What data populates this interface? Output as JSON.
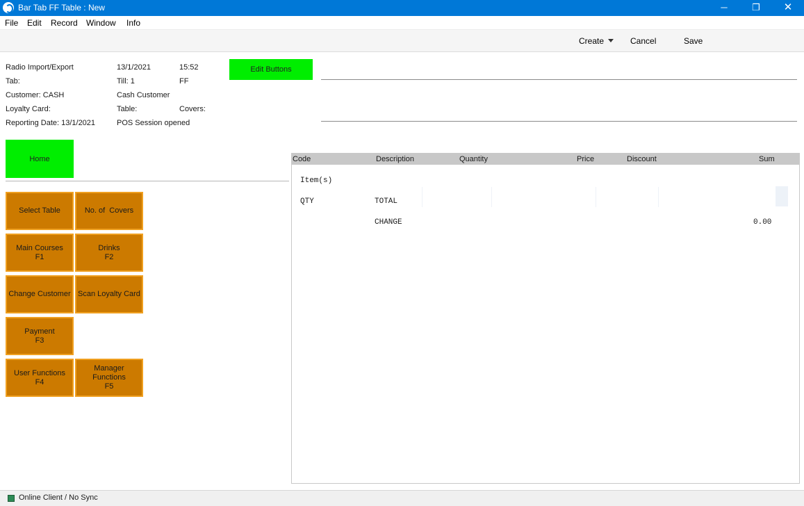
{
  "window": {
    "title": "Bar Tab FF Table : New",
    "minimize_glyph": "─",
    "maximize_glyph": "❐",
    "close_glyph": "✕"
  },
  "menu": [
    "File",
    "Edit",
    "Record",
    "Window",
    "Info"
  ],
  "toolbar": {
    "create_label": "Create",
    "cancel_label": "Cancel",
    "save_label": "Save"
  },
  "info": {
    "source": "Radio Import/Export",
    "date": "13/1/2021",
    "time": "15:52",
    "tab_label": "Tab:",
    "till": "Till: 1",
    "till_code": "FF",
    "customer": "Customer: CASH",
    "customer_name": "Cash Customer",
    "loyalty_card": "Loyalty Card:",
    "table_label": "Table:",
    "covers_label": "Covers:",
    "reporting_date": "Reporting Date: 13/1/2021",
    "session_status": "POS Session opened"
  },
  "buttons": {
    "edit_buttons": "Edit Buttons",
    "home": "Home",
    "select_table": "Select Table",
    "no_of_covers": "No. of  Covers",
    "main_courses": [
      "Main Courses",
      "F1"
    ],
    "drinks": [
      "Drinks",
      "F2"
    ],
    "change_customer": "Change Customer",
    "scan_loyalty_card": "Scan Loyalty Card",
    "payment": [
      "Payment",
      "F3"
    ],
    "user_functions": [
      "User Functions",
      "F4"
    ],
    "manager_functions": [
      "Manager",
      "Functions",
      "F5"
    ]
  },
  "table": {
    "columns": [
      "Code",
      "Description",
      "Quantity",
      "Price",
      "Discount",
      "Sum"
    ],
    "items_label": "Item(s)",
    "qty_label": "QTY",
    "total_label": "TOTAL",
    "change_label": "CHANGE",
    "change_value": "0.00"
  },
  "status": {
    "connection": "Online Client / No Sync",
    "indicator_color": "#2e8b57"
  },
  "colors": {
    "titlebar": "#0078d7",
    "green_button": "#00ee00",
    "orange_button": "#cc7a00",
    "orange_border": "#f0a020"
  }
}
